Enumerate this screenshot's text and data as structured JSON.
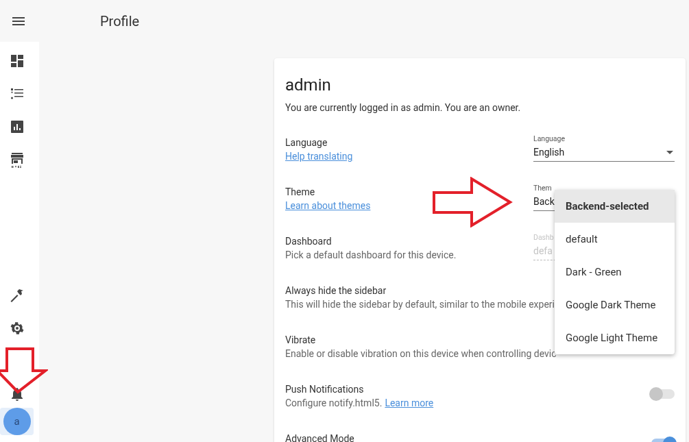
{
  "header": {
    "title": "Profile"
  },
  "sidebar": {
    "avatar": {
      "initial": "a",
      "selected": true
    }
  },
  "card": {
    "title": "admin",
    "subtitle": "You are currently logged in as admin. You are an owner.",
    "rows": [
      {
        "kind": "select",
        "title": "Language",
        "link": "Help translating",
        "field": {
          "label": "Language",
          "value": "English",
          "caret": true,
          "disabled": false
        }
      },
      {
        "kind": "select",
        "title": "Theme",
        "link": "Learn about themes",
        "field": {
          "label": "Them",
          "value": "Back",
          "disabled": false
        }
      },
      {
        "kind": "select",
        "title": "Dashboard",
        "description": "Pick a default dashboard for this device.",
        "field": {
          "label": "Dashb",
          "value": "defa",
          "disabled": true
        }
      },
      {
        "kind": "text",
        "title": "Always hide the sidebar",
        "description": "This will hide the sidebar by default, similar to the mobile experi"
      },
      {
        "kind": "text",
        "title": "Vibrate",
        "description": "Enable or disable vibration on this device when controlling devic"
      },
      {
        "kind": "toggle",
        "title": "Push Notifications",
        "description": "Configure notify.html5.",
        "link": "Learn more",
        "on": false
      },
      {
        "kind": "toggle",
        "title": "Advanced Mode",
        "on": true
      }
    ]
  },
  "menu": {
    "items": [
      {
        "label": "Backend-selected",
        "selected": true
      },
      {
        "label": "default",
        "selected": false
      },
      {
        "label": "Dark - Green",
        "selected": false
      },
      {
        "label": "Google Dark Theme",
        "selected": false
      },
      {
        "label": "Google Light Theme",
        "selected": false
      }
    ]
  }
}
